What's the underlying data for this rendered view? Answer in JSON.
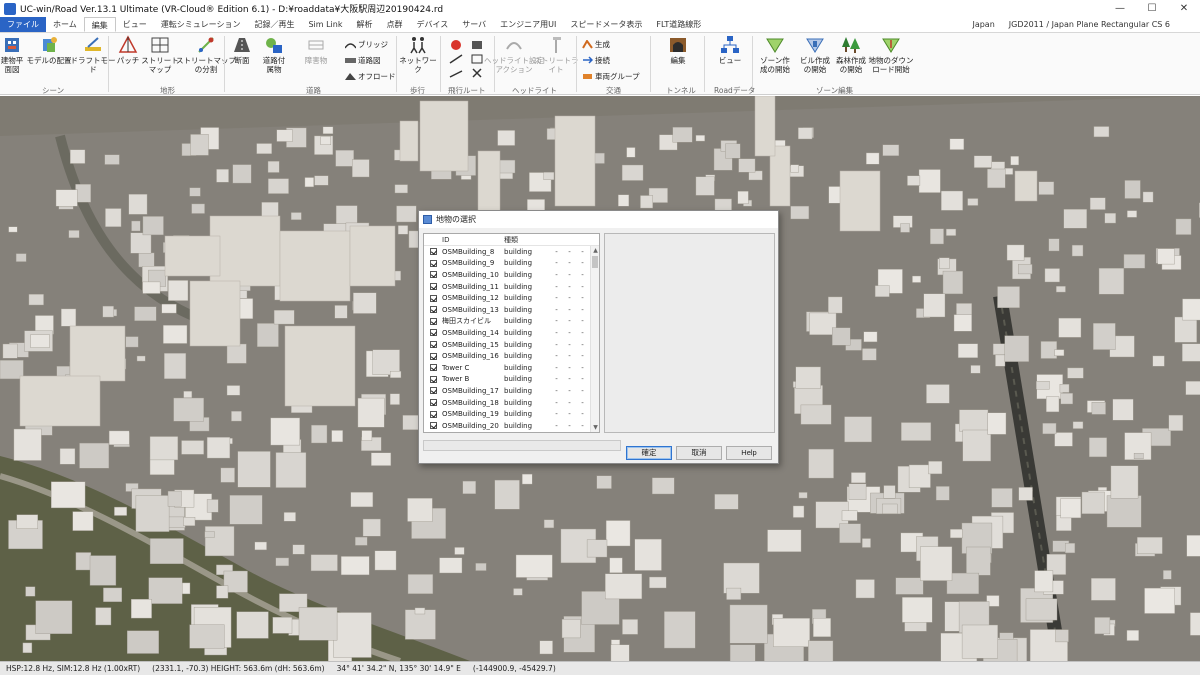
{
  "window": {
    "title": "UC-win/Road Ver.13.1 Ultimate (VR-Cloud® Edition 6.1) - D:¥roaddata¥大阪駅周辺20190424.rd",
    "controls": [
      "—",
      "☐",
      "✕"
    ]
  },
  "tabs": [
    "ファイル",
    "ホーム",
    "編集",
    "ビュー",
    "運転シミュレーション",
    "記録／再生",
    "Sim Link",
    "解析",
    "点群",
    "デバイス",
    "サーバ",
    "エンジニア用UI",
    "スピードメータ表示",
    "FLT道路線形"
  ],
  "active_tab": "編集",
  "tab_right": {
    "locale": "Japan",
    "crs": "JGD2011 / Japan Plane Rectangular CS 6"
  },
  "ribbon": {
    "buttons": [
      {
        "label": "建物平\n面図",
        "icon": "building-plan-icon"
      },
      {
        "label": "モデルの配置",
        "icon": "model-place-icon"
      },
      {
        "label": "ドラフトモー\nド",
        "icon": "draft-mode-icon"
      },
      {
        "label": "パッチ",
        "icon": "patch-icon"
      },
      {
        "label": "ストリート\nマップ",
        "icon": "street-map-icon"
      },
      {
        "label": "ストリートマップ\nの分割",
        "icon": "street-map-split-icon"
      },
      {
        "label": "断面",
        "icon": "section-icon"
      },
      {
        "label": "道路付\n属物",
        "icon": "road-attachment-icon"
      },
      {
        "label": "障害物",
        "icon": "obstacle-icon",
        "disabled": true
      },
      {
        "label": "ネットワーク",
        "icon": "network-icon"
      },
      {
        "label": "ヘッドライト設定\nアクション",
        "icon": "headlight-icon",
        "disabled": true
      },
      {
        "label": "ストリートライト",
        "icon": "streetlight-icon",
        "disabled": true
      },
      {
        "label": "編集",
        "icon": "tunnel-edit-icon"
      },
      {
        "label": "ビュー",
        "icon": "road-data-view-icon"
      },
      {
        "label": "ゾーン作\n成の開始",
        "icon": "zone-create-icon"
      },
      {
        "label": "ビル作成\nの開始",
        "icon": "building-create-icon"
      },
      {
        "label": "森林作成\nの開始",
        "icon": "forest-create-icon"
      },
      {
        "label": "地物のダウン\nロード開始",
        "icon": "feature-download-icon"
      }
    ],
    "small_buttons": {
      "bridge": "ブリッジ",
      "road_plan": "道路図",
      "offroad": "オフロード",
      "generate": "生成",
      "connect": "接続",
      "vehicle_group": "車両グループ"
    },
    "groups": [
      "シーン",
      "地形",
      "道路",
      "歩行",
      "飛行ルート",
      "ヘッドライト",
      "交通",
      "トンネル",
      "Roadデータ",
      "ゾーン編集"
    ]
  },
  "dialog": {
    "title": "地物の選択",
    "columns": {
      "id": "ID",
      "type": "種類"
    },
    "rows": [
      {
        "id": "OSMBuilding_8",
        "type": "building",
        "a": "-",
        "b": "-",
        "c": "-"
      },
      {
        "id": "OSMBuilding_9",
        "type": "building",
        "a": "-",
        "b": "-",
        "c": "-"
      },
      {
        "id": "OSMBuilding_10",
        "type": "building",
        "a": "-",
        "b": "-",
        "c": "-"
      },
      {
        "id": "OSMBuilding_11",
        "type": "building",
        "a": "-",
        "b": "-",
        "c": "-"
      },
      {
        "id": "OSMBuilding_12",
        "type": "building",
        "a": "-",
        "b": "-",
        "c": "-"
      },
      {
        "id": "OSMBuilding_13",
        "type": "building",
        "a": "-",
        "b": "-",
        "c": "-"
      },
      {
        "id": "梅田スカイビル",
        "type": "building",
        "a": "-",
        "b": "-",
        "c": "-"
      },
      {
        "id": "OSMBuilding_14",
        "type": "building",
        "a": "-",
        "b": "-",
        "c": "-"
      },
      {
        "id": "OSMBuilding_15",
        "type": "building",
        "a": "-",
        "b": "-",
        "c": "-"
      },
      {
        "id": "OSMBuilding_16",
        "type": "building",
        "a": "-",
        "b": "-",
        "c": "-"
      },
      {
        "id": "Tower C",
        "type": "building",
        "a": "-",
        "b": "-",
        "c": "-"
      },
      {
        "id": "Tower B",
        "type": "building",
        "a": "-",
        "b": "-",
        "c": "-"
      },
      {
        "id": "OSMBuilding_17",
        "type": "building",
        "a": "-",
        "b": "-",
        "c": "-"
      },
      {
        "id": "OSMBuilding_18",
        "type": "building",
        "a": "-",
        "b": "-",
        "c": "-"
      },
      {
        "id": "OSMBuilding_19",
        "type": "building",
        "a": "-",
        "b": "-",
        "c": "-"
      },
      {
        "id": "OSMBuilding_20",
        "type": "building",
        "a": "-",
        "b": "-",
        "c": "-"
      }
    ],
    "buttons": {
      "ok": "確定",
      "cancel": "取消",
      "help": "Help"
    }
  },
  "status": {
    "rate": "HSP:12.8 Hz, SIM:12.8 Hz (1.00xRT)",
    "position": "(2331.1, -70.3)  HEIGHT: 563.6m (dH: 563.6m)",
    "latlon": "34° 41' 34.2\" N, 135° 30' 14.9\" E",
    "xy": "(-144900.9, -45429.7)"
  },
  "colors": {
    "accent": "#2a64c5",
    "viewport_ground": "#8f8c84",
    "building": "#e6e2db"
  }
}
